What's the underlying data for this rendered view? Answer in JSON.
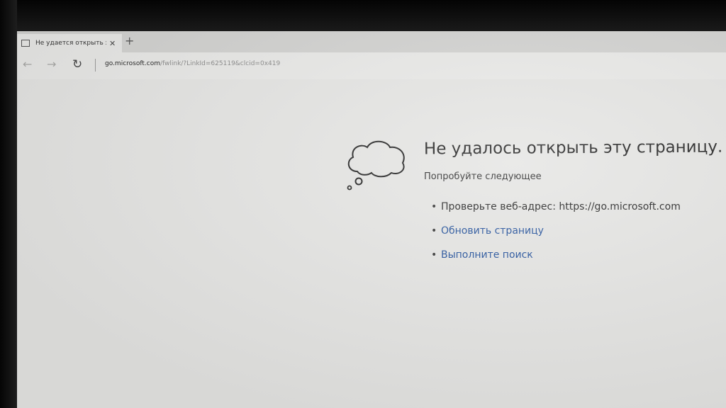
{
  "browser": {
    "tab": {
      "title": "Не удается открыть эту",
      "close_icon": "close-icon",
      "page_icon": "page-icon"
    },
    "new_tab_label": "+",
    "nav": {
      "back_icon": "arrow-left-icon",
      "forward_icon": "arrow-right-icon",
      "refresh_icon": "refresh-icon"
    },
    "address": {
      "host": "go.microsoft.com",
      "path": "/fwlink/?LinkId=625119&clcid=0x419"
    }
  },
  "error_page": {
    "icon": "thought-cloud-icon",
    "title": "Не удалось открыть эту страницу.",
    "suggest_label": "Попробуйте следующее",
    "items": [
      {
        "text": "Проверьте веб-адрес: https://go.microsoft.com"
      },
      {
        "text": "Обновить страницу"
      },
      {
        "text": "Выполните поиск"
      }
    ]
  },
  "colors": {
    "link": "#1f4e9a",
    "page_background": "#e5e5e3"
  }
}
